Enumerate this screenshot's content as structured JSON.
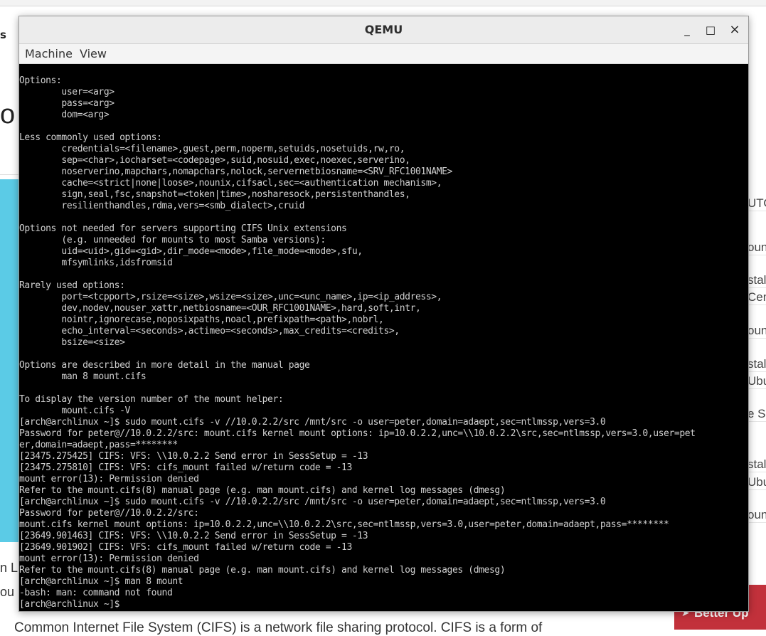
{
  "background_page": {
    "nav_fragment": "s",
    "heading_fragment": "o",
    "left_fragments": [
      "n L",
      "ou"
    ],
    "sidebar_fragments": [
      "UTO",
      "oun",
      "stall",
      "Cen",
      "oun",
      "stall",
      "Ubu",
      "e SS",
      "stall",
      "Ubu",
      "oun"
    ],
    "bottom_text": "Common Internet File System (CIFS) is a network file sharing protocol. CIFS is a form of",
    "banner_label": "Better Up"
  },
  "window": {
    "title": "QEMU",
    "minimize_label": "_",
    "maximize_label": "□",
    "close_label": "×"
  },
  "menu": {
    "items": [
      "Machine",
      "View"
    ]
  },
  "terminal": {
    "lines": [
      "",
      "Options:",
      "        user=<arg>",
      "        pass=<arg>",
      "        dom=<arg>",
      "",
      "Less commonly used options:",
      "        credentials=<filename>,guest,perm,noperm,setuids,nosetuids,rw,ro,",
      "        sep=<char>,iocharset=<codepage>,suid,nosuid,exec,noexec,serverino,",
      "        noserverino,mapchars,nomapchars,nolock,servernetbiosname=<SRV_RFC1001NAME>",
      "        cache=<strict|none|loose>,nounix,cifsacl,sec=<authentication mechanism>,",
      "        sign,seal,fsc,snapshot=<token|time>,nosharesock,persistenthandles,",
      "        resilienthandles,rdma,vers=<smb_dialect>,cruid",
      "",
      "Options not needed for servers supporting CIFS Unix extensions",
      "        (e.g. unneeded for mounts to most Samba versions):",
      "        uid=<uid>,gid=<gid>,dir_mode=<mode>,file_mode=<mode>,sfu,",
      "        mfsymlinks,idsfromsid",
      "",
      "Rarely used options:",
      "        port=<tcpport>,rsize=<size>,wsize=<size>,unc=<unc_name>,ip=<ip_address>,",
      "        dev,nodev,nouser_xattr,netbiosname=<OUR_RFC1001NAME>,hard,soft,intr,",
      "        nointr,ignorecase,noposixpaths,noacl,prefixpath=<path>,nobrl,",
      "        echo_interval=<seconds>,actimeo=<seconds>,max_credits=<credits>,",
      "        bsize=<size>",
      "",
      "Options are described in more detail in the manual page",
      "        man 8 mount.cifs",
      "",
      "To display the version number of the mount helper:",
      "        mount.cifs -V",
      "[arch@archlinux ~]$ sudo mount.cifs -v //10.0.2.2/src /mnt/src -o user=peter,domain=adaept,sec=ntlmssp,vers=3.0",
      "Password for peter@//10.0.2.2/src: mount.cifs kernel mount options: ip=10.0.2.2,unc=\\\\10.0.2.2\\src,sec=ntlmssp,vers=3.0,user=pet",
      "er,domain=adaept,pass=********",
      "[23475.275425] CIFS: VFS: \\\\10.0.2.2 Send error in SessSetup = -13",
      "[23475.275810] CIFS: VFS: cifs_mount failed w/return code = -13",
      "mount error(13): Permission denied",
      "Refer to the mount.cifs(8) manual page (e.g. man mount.cifs) and kernel log messages (dmesg)",
      "[arch@archlinux ~]$ sudo mount.cifs -v //10.0.2.2/src /mnt/src -o user=peter,domain=adaept,sec=ntlmssp,vers=3.0",
      "Password for peter@//10.0.2.2/src:",
      "mount.cifs kernel mount options: ip=10.0.2.2,unc=\\\\10.0.2.2\\src,sec=ntlmssp,vers=3.0,user=peter,domain=adaept,pass=********",
      "[23649.901463] CIFS: VFS: \\\\10.0.2.2 Send error in SessSetup = -13",
      "[23649.901902] CIFS: VFS: cifs_mount failed w/return code = -13",
      "mount error(13): Permission denied",
      "Refer to the mount.cifs(8) manual page (e.g. man mount.cifs) and kernel log messages (dmesg)",
      "[arch@archlinux ~]$ man 8 mount",
      "-bash: man: command not found",
      "[arch@archlinux ~]$"
    ]
  }
}
